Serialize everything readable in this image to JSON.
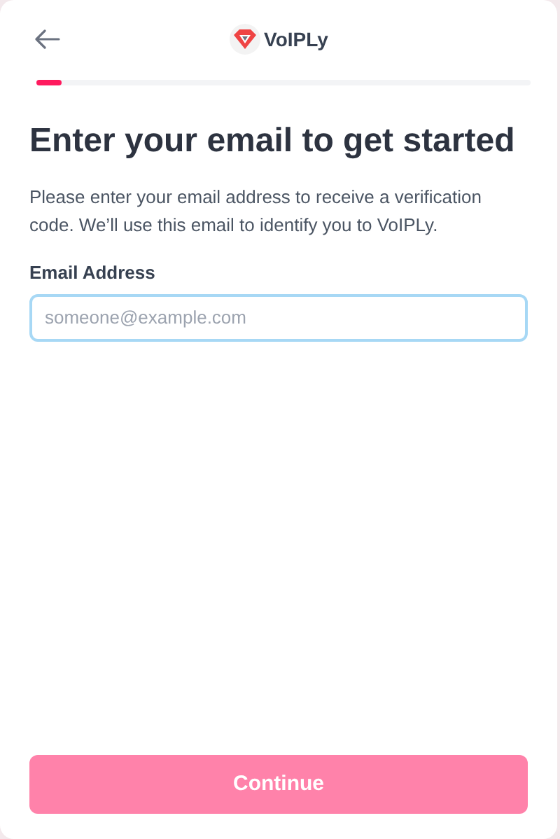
{
  "header": {
    "brand": "VoIPLy"
  },
  "progress": {
    "level": 0.05
  },
  "title": "Enter your email to get started",
  "description": "Please enter your email address to receive a verification code. We’ll use this email to identify you to VoIPLy.",
  "email_field": {
    "label": "Email Address",
    "placeholder": "someone@example.com",
    "focused": true
  },
  "continue_button": {
    "label": "Continue",
    "disabled": true
  }
}
